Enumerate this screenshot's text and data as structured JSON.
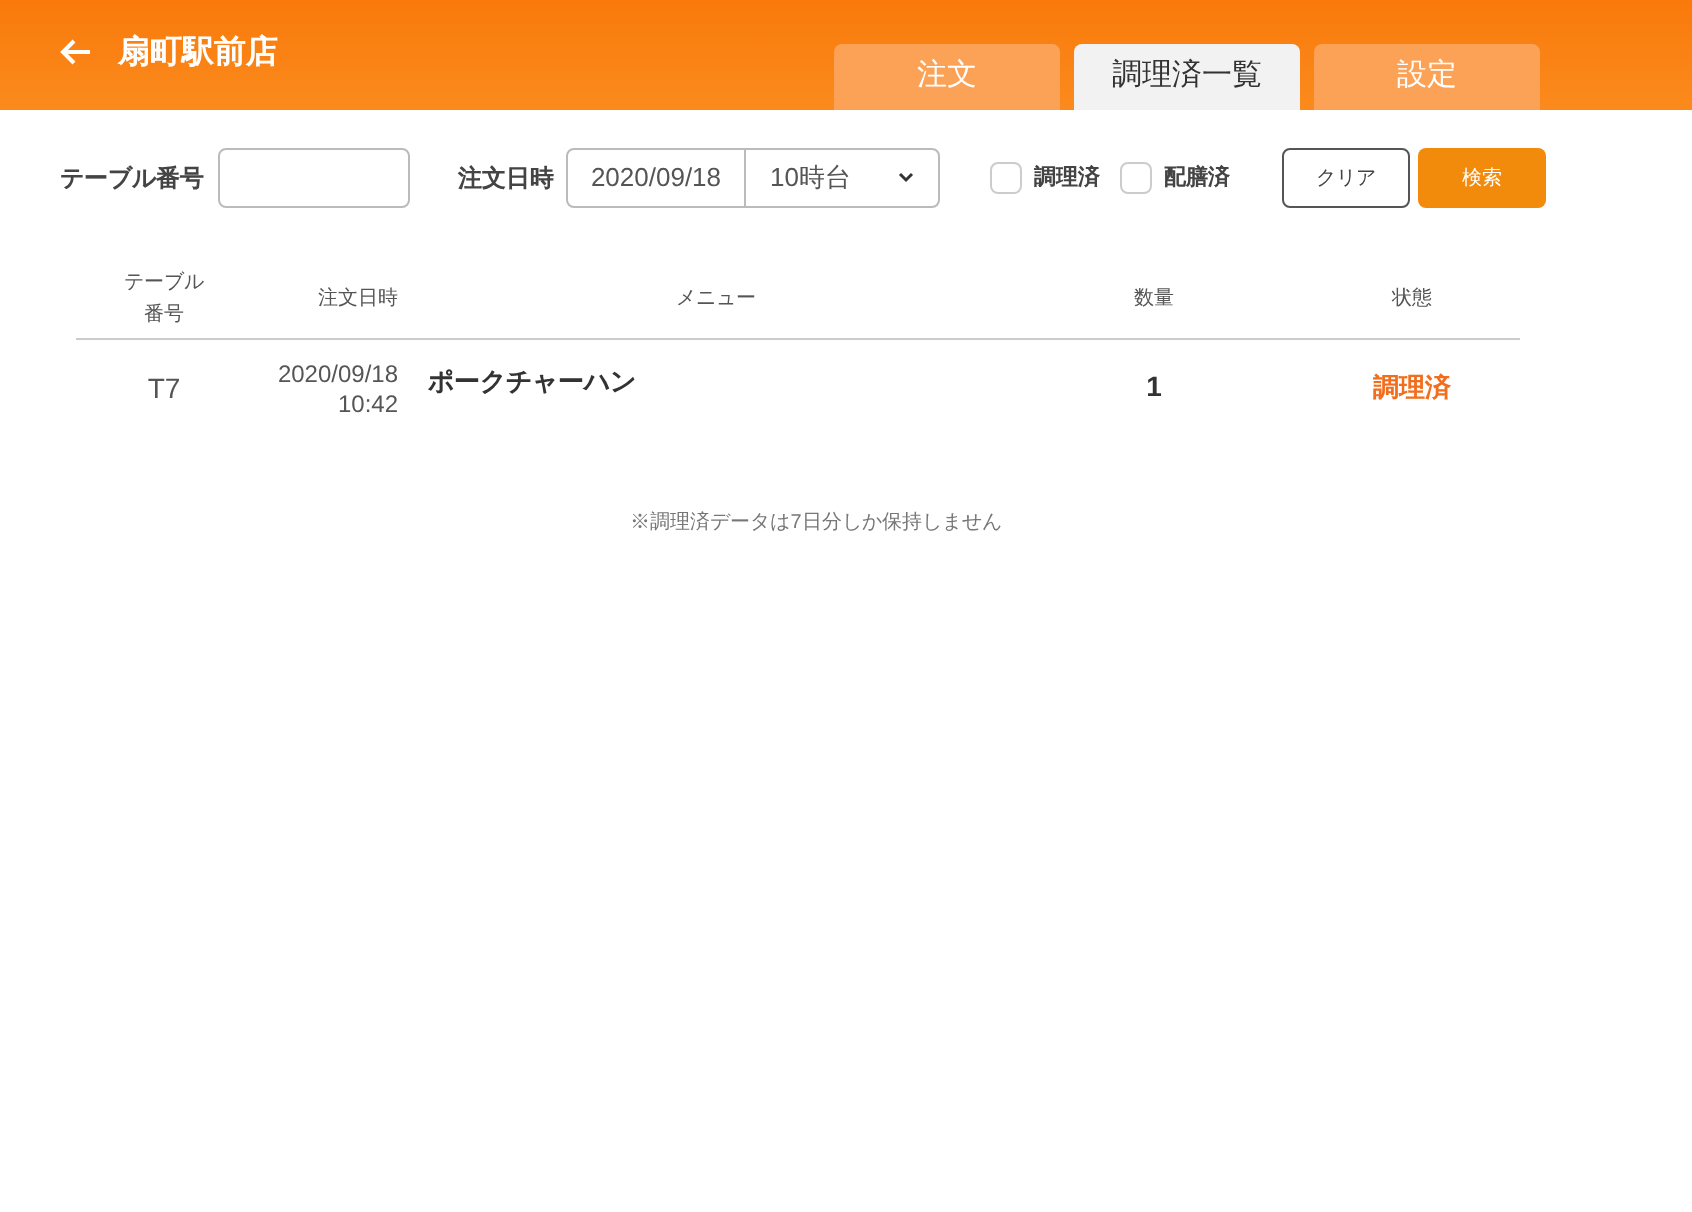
{
  "header": {
    "title": "扇町駅前店"
  },
  "tabs": [
    {
      "label": "注文",
      "selected": false
    },
    {
      "label": "調理済一覧",
      "selected": true
    },
    {
      "label": "設定",
      "selected": false
    }
  ],
  "filters": {
    "table_label": "テーブル番号",
    "date_label": "注文日時",
    "date_value": "2020/09/18",
    "hour_value": "10時台",
    "checkboxes": [
      {
        "label": "調理済",
        "checked": false
      },
      {
        "label": "配膳済",
        "checked": false
      }
    ],
    "clear_button": "クリア",
    "search_button": "検索"
  },
  "table": {
    "columns": [
      "テーブル番号",
      "注文日時",
      "メニュー",
      "数量",
      "状態"
    ],
    "rows": [
      {
        "table_number": "T7",
        "date": "2020/09/18",
        "time": "10:42",
        "menu": "ポークチャーハン",
        "quantity": "1",
        "status": "調理済"
      }
    ]
  },
  "note": "※調理済データは7日分しか保持しません"
}
